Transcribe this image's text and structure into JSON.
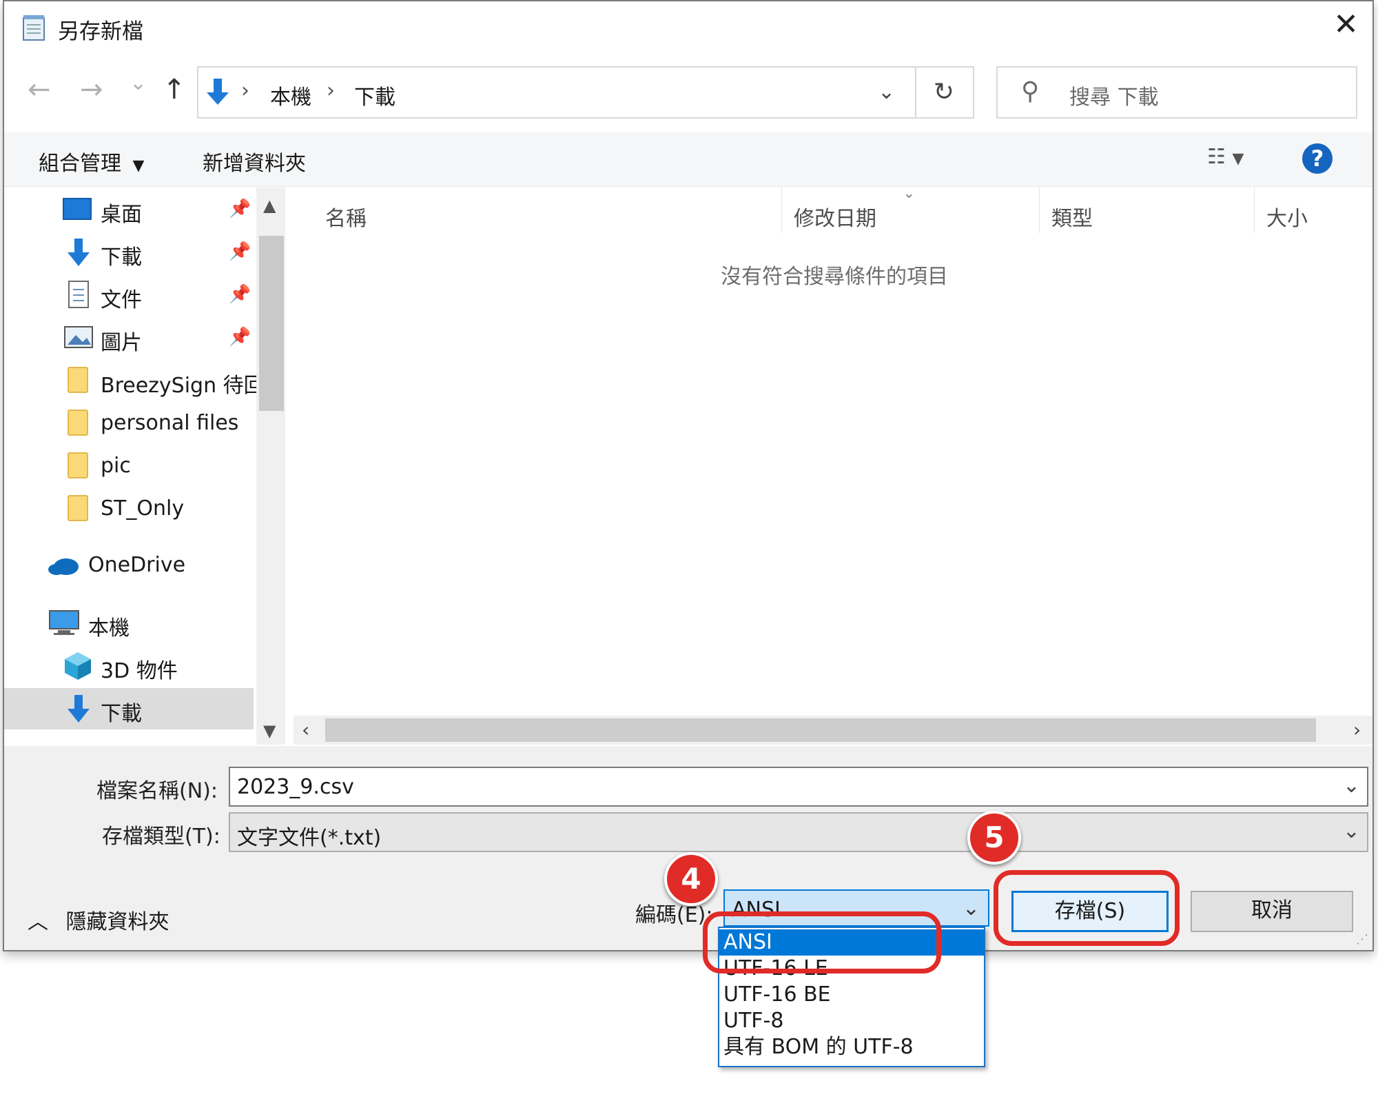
{
  "window": {
    "title": "另存新檔",
    "close_icon": "close-icon"
  },
  "nav": {
    "back": "←",
    "forward": "→",
    "recent": "⌄",
    "up": "↑",
    "path": [
      "本機",
      "下載"
    ],
    "refresh": "↻",
    "search_placeholder": "搜尋 下載"
  },
  "toolbar": {
    "organize": "組合管理",
    "new_folder": "新增資料夾",
    "view_icon": "view-options-icon",
    "help": "?"
  },
  "sidebar": {
    "items": [
      {
        "label": "桌面",
        "icon": "desktop-icon",
        "pinned": true
      },
      {
        "label": "下載",
        "icon": "download-icon",
        "pinned": true
      },
      {
        "label": "文件",
        "icon": "document-icon",
        "pinned": true
      },
      {
        "label": "圖片",
        "icon": "pictures-icon",
        "pinned": true
      },
      {
        "label": "BreezySign 待回",
        "icon": "folder-icon"
      },
      {
        "label": "personal files",
        "icon": "folder-icon"
      },
      {
        "label": "pic",
        "icon": "folder-icon"
      },
      {
        "label": "ST_Only",
        "icon": "folder-icon"
      },
      {
        "label": "OneDrive",
        "icon": "onedrive-icon"
      },
      {
        "label": "本機",
        "icon": "computer-icon"
      },
      {
        "label": "3D 物件",
        "icon": "3d-objects-icon"
      },
      {
        "label": "下載",
        "icon": "download-icon",
        "selected": true
      }
    ]
  },
  "file_list": {
    "columns": [
      "名稱",
      "修改日期",
      "類型",
      "大小"
    ],
    "empty_message": "沒有符合搜尋條件的項目"
  },
  "form": {
    "filename_label": "檔案名稱(N):",
    "filename_value": "2023_9.csv",
    "filetype_label": "存檔類型(T):",
    "filetype_value": "文字文件(*.txt)",
    "hide_folders": "隱藏資料夾",
    "encoding_label": "編碼(E):",
    "encoding_value": "ANSI",
    "encoding_options": [
      "ANSI",
      "UTF-16 LE",
      "UTF-16 BE",
      "UTF-8",
      "具有 BOM 的 UTF-8"
    ],
    "save_button": "存檔(S)",
    "cancel_button": "取消"
  },
  "annotations": {
    "step4": "4",
    "step5": "5",
    "highlight_color": "#e02b27"
  }
}
